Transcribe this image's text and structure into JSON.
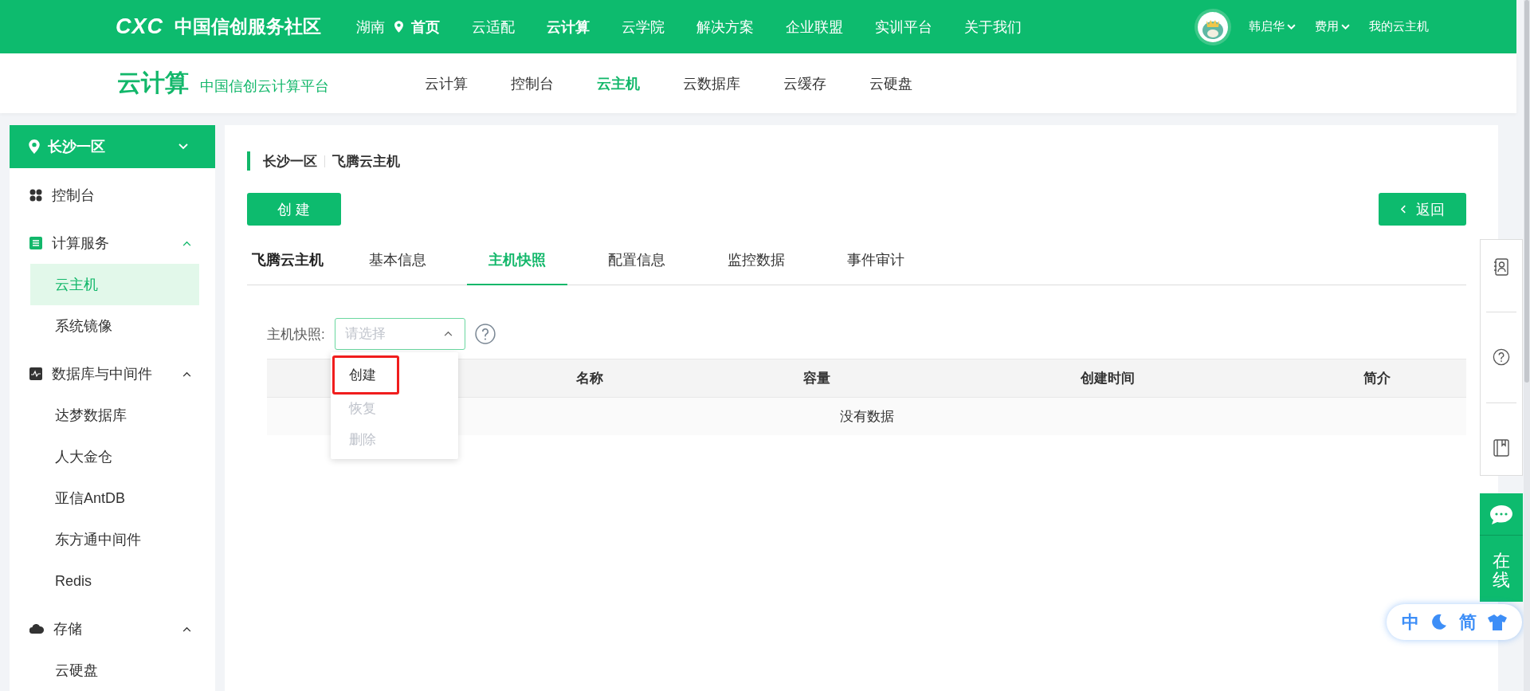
{
  "header": {
    "logo_mark": "CXC",
    "logo_text": "中国信创服务社区",
    "region": "湖南",
    "nav": [
      {
        "label": "首页",
        "selected": true
      },
      {
        "label": "云适配",
        "selected": false
      },
      {
        "label": "云计算",
        "selected": true
      },
      {
        "label": "云学院",
        "selected": false
      },
      {
        "label": "解决方案",
        "selected": false
      },
      {
        "label": "企业联盟",
        "selected": false
      },
      {
        "label": "实训平台",
        "selected": false
      },
      {
        "label": "关于我们",
        "selected": false
      }
    ],
    "user_menus": [
      {
        "label": "韩启华",
        "kind": "dropdown"
      },
      {
        "label": "费用",
        "kind": "dropdown"
      },
      {
        "label": "我的云主机",
        "kind": "link"
      }
    ]
  },
  "subnav": {
    "title": "云计算",
    "tagline": "中国信创云计算平台",
    "items": [
      {
        "label": "云计算",
        "selected": false
      },
      {
        "label": "控制台",
        "selected": false
      },
      {
        "label": "云主机",
        "selected": true
      },
      {
        "label": "云数据库",
        "selected": false
      },
      {
        "label": "云缓存",
        "selected": false
      },
      {
        "label": "云硬盘",
        "selected": false
      }
    ]
  },
  "sidebar": {
    "region": "长沙一区",
    "items": [
      {
        "label": "控制台",
        "kind": "grid"
      },
      {
        "label": "计算服务",
        "kind": "list",
        "expanded": true,
        "children": [
          {
            "label": "云主机",
            "selected": true
          },
          {
            "label": "系统镜像",
            "selected": false
          }
        ]
      },
      {
        "label": "数据库与中间件",
        "kind": "pulse",
        "expanded": true,
        "children": [
          {
            "label": "达梦数据库",
            "selected": false
          },
          {
            "label": "人大金仓",
            "selected": false
          },
          {
            "label": "亚信AntDB",
            "selected": false
          },
          {
            "label": "东方通中间件",
            "selected": false
          },
          {
            "label": "Redis",
            "selected": false
          }
        ]
      },
      {
        "label": "存储",
        "kind": "cloud",
        "expanded": true,
        "children": [
          {
            "label": "云硬盘",
            "selected": false
          }
        ]
      }
    ]
  },
  "main": {
    "breadcrumb": [
      "长沙一区",
      "飞腾云主机"
    ],
    "create_button": "创 建",
    "back_button": "返回",
    "tabs": [
      {
        "label": "飞腾云主机",
        "kind": "title"
      },
      {
        "label": "基本信息",
        "kind": "tab",
        "selected": false
      },
      {
        "label": "主机快照",
        "kind": "tab",
        "selected": true
      },
      {
        "label": "配置信息",
        "kind": "tab",
        "selected": false
      },
      {
        "label": "监控数据",
        "kind": "tab",
        "selected": false
      },
      {
        "label": "事件审计",
        "kind": "tab",
        "selected": false
      }
    ],
    "snapshot_select": {
      "label": "主机快照:",
      "placeholder": "请选择",
      "expanded": true,
      "options": [
        {
          "label": "创建",
          "disabled": false,
          "highlighted": true
        },
        {
          "label": "恢复",
          "disabled": true,
          "highlighted": false
        },
        {
          "label": "删除",
          "disabled": true,
          "highlighted": false
        }
      ]
    },
    "table": {
      "columns": [
        "名称",
        "容量",
        "创建时间",
        "简介"
      ],
      "empty_text": "没有数据"
    }
  },
  "side_tools": [
    {
      "kind": "contact"
    },
    {
      "kind": "help"
    },
    {
      "kind": "book"
    }
  ],
  "chat": {
    "label": "在线"
  },
  "ime_bar": [
    {
      "kind": "text",
      "label": "中"
    },
    {
      "kind": "moon"
    },
    {
      "kind": "text",
      "label": "简"
    },
    {
      "kind": "shirt"
    }
  ]
}
